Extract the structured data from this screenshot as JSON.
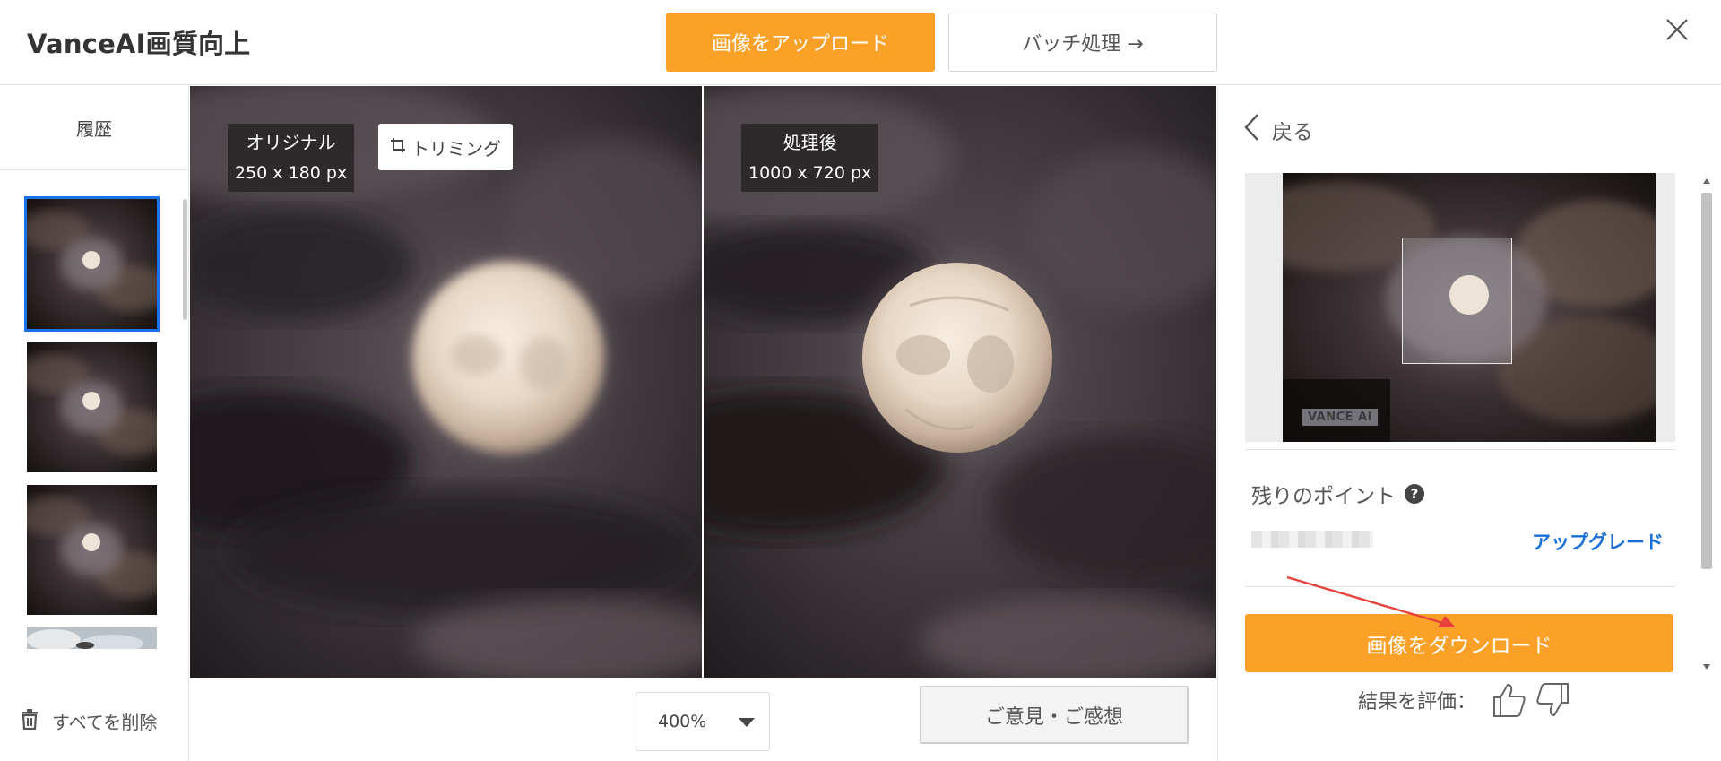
{
  "app": {
    "title": "VanceAI画質向上"
  },
  "header": {
    "upload_label": "画像をアップロード",
    "batch_label": "バッチ処理 →"
  },
  "history": {
    "title": "履歴",
    "delete_all": "すべてを削除"
  },
  "viewer": {
    "original_label": "オリジナル",
    "original_size": "250 x 180 px",
    "crop_label": "トリミング",
    "processed_label": "処理後",
    "processed_size": "1000 x 720 px"
  },
  "bottom": {
    "zoom_value": "400%",
    "feedback_label": "ご意見・ご感想"
  },
  "panel": {
    "back_label": "戻る",
    "watermark": "VANCE AI",
    "points_label": "残りのポイント",
    "upgrade_label": "アップグレード",
    "download_label": "画像をダウンロード",
    "rate_label": "結果を評価："
  },
  "colors": {
    "accent_orange": "#fca128",
    "link_blue": "#1a6fd6",
    "selected_outline": "#1a73e8",
    "annotation_red": "#e8403a"
  }
}
